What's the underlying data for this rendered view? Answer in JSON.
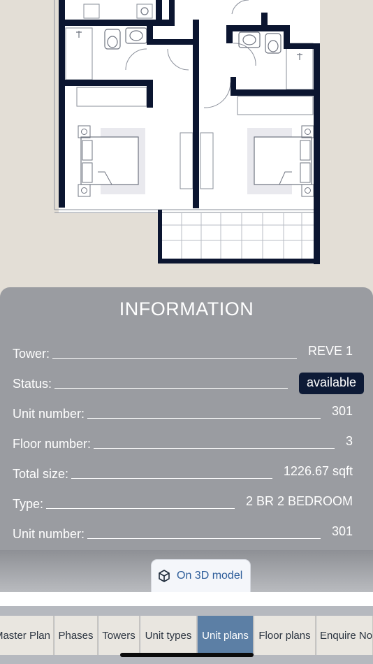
{
  "info": {
    "title": "INFORMATION",
    "rows": [
      {
        "label": "Tower:",
        "value": "REVE 1"
      },
      {
        "label": "Status:",
        "value": "available"
      },
      {
        "label": "Unit number:",
        "value": "301"
      },
      {
        "label": "Floor number:",
        "value": "3"
      },
      {
        "label": "Total size:",
        "value": "1226.67 sqft"
      },
      {
        "label": "Type:",
        "value": "2 BR 2 BEDROOM"
      },
      {
        "label": "Unit number:",
        "value": "301"
      }
    ]
  },
  "model_button": {
    "label": "On 3D model",
    "icon": "cube-icon"
  },
  "tabs": [
    {
      "label": "Master Plan"
    },
    {
      "label": "Phases"
    },
    {
      "label": "Towers"
    },
    {
      "label": "Unit types"
    },
    {
      "label": "Unit plans",
      "active": true
    },
    {
      "label": "Floor plans"
    },
    {
      "label": "Enquire Now"
    }
  ],
  "colors": {
    "background": "#e3ded6",
    "panel": "#9a9ca1",
    "badge": "#0d1a36",
    "active_tab": "#5c7fa5",
    "wall": "#0b1530"
  }
}
